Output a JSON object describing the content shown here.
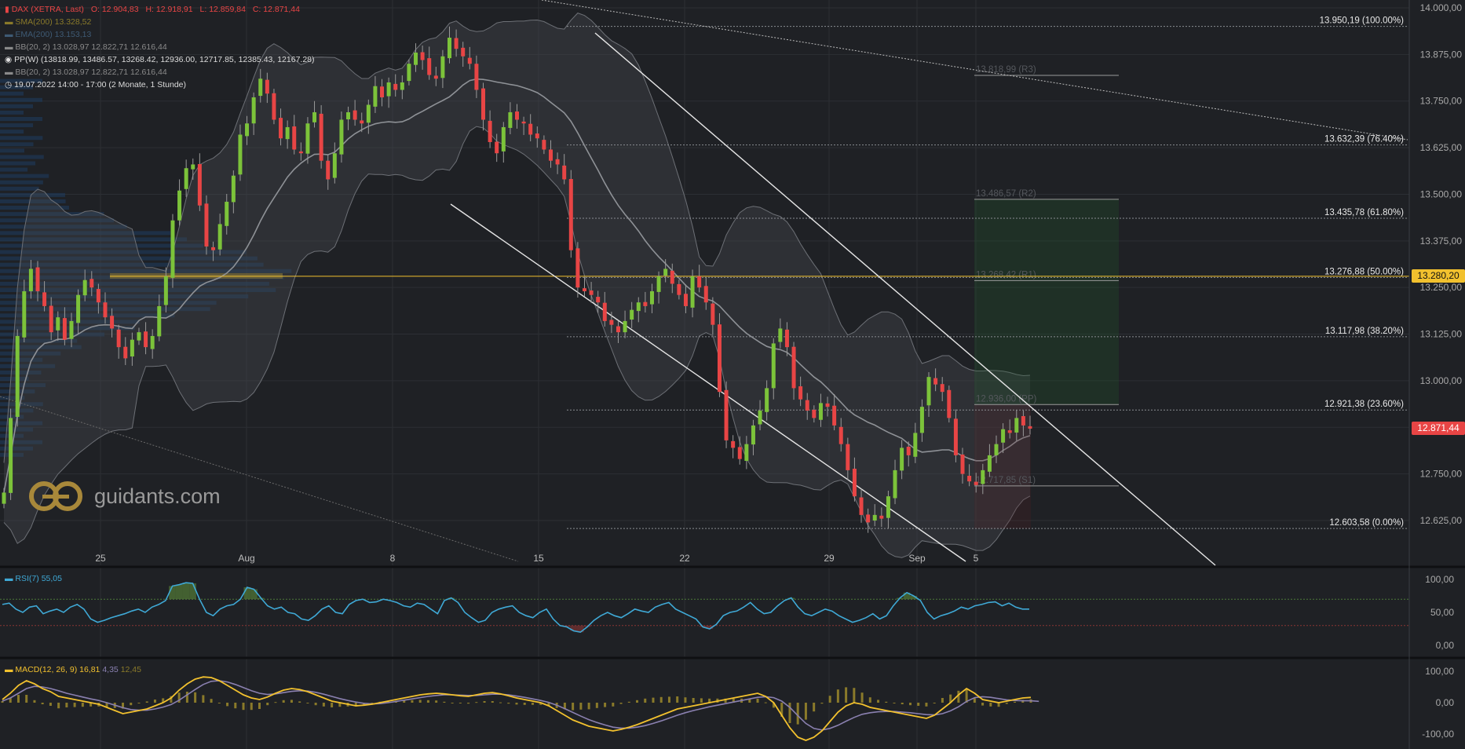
{
  "header": {
    "instrument": "DAX (XETRA, Last)",
    "ohlc": {
      "o": "O: 12.904,83",
      "h": "H: 12.918,91",
      "l": "L: 12.859,84",
      "c": "C: 12.871,44"
    },
    "indicators": [
      {
        "label": "SMA(200)",
        "value": "13.328,52",
        "color": "#8a7a2a"
      },
      {
        "label": "EMA(200)",
        "value": "13.153,13",
        "color": "#3e5a74"
      },
      {
        "label": "BB(20, 2)",
        "value": "13.028,97  12.822,71  12.616,44",
        "color": "#8a8a8a"
      },
      {
        "label": "PP(W)",
        "value": "(13818.99, 13486.57, 13268.42, 12936.00, 12717.85, 12385.43, 12167.28)",
        "color": "#e0e0e0"
      },
      {
        "label": "BB(20, 2)",
        "value": "13.028,97  12.822,71  12.616,44",
        "color": "#8a8a8a"
      },
      {
        "label": "19.07.2022 14:00 - 17:00",
        "value": "(2 Monate, 1 Stunde)",
        "color": "#e0e0e0"
      }
    ]
  },
  "logo": {
    "text": "guidants.com"
  },
  "price_tags": {
    "hline": {
      "text": "13.280,20",
      "color": "#f2c12e"
    },
    "last": {
      "text": "12.871,44",
      "color": "#e84545"
    }
  },
  "chart_data": [
    {
      "type": "candlestick",
      "name": "price",
      "x_tick_labels": [
        "25",
        "Aug",
        "8",
        "15",
        "22",
        "29",
        "Sep",
        "5"
      ],
      "y_tick_labels": [
        "14.000,00",
        "13.875,00",
        "13.750,00",
        "13.625,00",
        "13.500,00",
        "13.375,00",
        "13.250,00",
        "13.125,00",
        "13.000,00",
        "12.875,00",
        "12.750,00",
        "12.625,00"
      ],
      "ylim": [
        12555,
        14000
      ],
      "fib_levels": [
        {
          "label": "13.950,19 (100.00%)",
          "value": 13950.19
        },
        {
          "label": "13.632,39 (76.40%)",
          "value": 13632.39
        },
        {
          "label": "13.435,78 (61.80%)",
          "value": 13435.78
        },
        {
          "label": "13.276,88 (50.00%)",
          "value": 13276.88
        },
        {
          "label": "13.117,98 (38.20%)",
          "value": 13117.98
        },
        {
          "label": "12.921,38 (23.60%)",
          "value": 12921.38
        },
        {
          "label": "12.603,58 (0.00%)",
          "value": 12603.58
        }
      ],
      "pivot_levels": [
        {
          "label": "13.818,99 (R3)",
          "value": 13818.99
        },
        {
          "label": "13.486,57 (R2)",
          "value": 13486.57
        },
        {
          "label": "13.268,42 (R1)",
          "value": 13268.42
        },
        {
          "label": "12.936,00 (PP)",
          "value": 12936.0
        },
        {
          "label": "12.717,85 (S1)",
          "value": 12717.85
        }
      ],
      "horizontal_line": 13280.2,
      "last_price": 12871.44,
      "series": [
        {
          "name": "close",
          "values": [
            12700,
            12900,
            13120,
            13240,
            13300,
            13240,
            13200,
            13130,
            13170,
            13110,
            13160,
            13230,
            13270,
            13250,
            13210,
            13170,
            13140,
            13090,
            13060,
            13110,
            13130,
            13090,
            13120,
            13200,
            13280,
            13430,
            13510,
            13570,
            13580,
            13470,
            13360,
            13350,
            13420,
            13480,
            13550,
            13660,
            13690,
            13760,
            13810,
            13770,
            13700,
            13650,
            13680,
            13620,
            13610,
            13690,
            13720,
            13590,
            13540,
            13610,
            13700,
            13720,
            13700,
            13690,
            13740,
            13790,
            13760,
            13800,
            13780,
            13800,
            13850,
            13880,
            13860,
            13820,
            13810,
            13870,
            13920,
            13890,
            13870,
            13850,
            13780,
            13700,
            13640,
            13610,
            13680,
            13720,
            13700,
            13690,
            13660,
            13650,
            13620,
            13590,
            13580,
            13540,
            13350,
            13250,
            13240,
            13230,
            13210,
            13160,
            13150,
            13130,
            13160,
            13190,
            13210,
            13200,
            13240,
            13280,
            13300,
            13260,
            13230,
            13200,
            13280,
            13250,
            13210,
            13150,
            12970,
            12840,
            12820,
            12790,
            12830,
            12880,
            12920,
            12980,
            13100,
            13140,
            13090,
            12980,
            12950,
            12920,
            12900,
            12940,
            12930,
            12880,
            12830,
            12760,
            12690,
            12640,
            12620,
            12640,
            12630,
            12690,
            12760,
            12820,
            12800,
            12860,
            12930,
            13010,
            12990,
            12970,
            12900,
            12800,
            12750,
            12730,
            12720,
            12760,
            12800,
            12830,
            12870,
            12860,
            12900,
            12880,
            12871.44
          ]
        }
      ],
      "overlays": [
        "SMA(200)",
        "EMA(200)",
        "BB(20, 2)",
        "PP(W)",
        "Fibonacci retracement",
        "trend channel",
        "volume profile"
      ]
    },
    {
      "type": "line",
      "name": "RSI(7)",
      "label": "RSI(7)",
      "value_text": "55,05",
      "y_tick_labels": [
        "100,00",
        "50,00",
        "0,00"
      ],
      "ylim": [
        -10,
        115
      ],
      "bands": [
        70,
        30
      ],
      "series": [
        {
          "name": "RSI(7)",
          "values": [
            62,
            64,
            55,
            50,
            58,
            60,
            48,
            52,
            55,
            50,
            58,
            62,
            55,
            40,
            35,
            38,
            42,
            45,
            48,
            52,
            55,
            50,
            58,
            62,
            68,
            90,
            92,
            95,
            94,
            70,
            50,
            45,
            55,
            60,
            62,
            70,
            88,
            85,
            72,
            60,
            55,
            58,
            50,
            48,
            40,
            38,
            45,
            55,
            60,
            50,
            48,
            62,
            68,
            70,
            65,
            66,
            70,
            68,
            65,
            60,
            58,
            64,
            62,
            55,
            48,
            68,
            72,
            65,
            50,
            42,
            35,
            38,
            50,
            55,
            58,
            60,
            50,
            45,
            42,
            50,
            55,
            40,
            30,
            28,
            22,
            20,
            28,
            38,
            45,
            50,
            45,
            42,
            48,
            55,
            52,
            50,
            58,
            62,
            65,
            55,
            50,
            45,
            40,
            28,
            25,
            32,
            45,
            50,
            52,
            58,
            65,
            55,
            48,
            50,
            60,
            68,
            72,
            58,
            48,
            45,
            50,
            55,
            52,
            45,
            40,
            35,
            38,
            42,
            48,
            40,
            45,
            60,
            72,
            80,
            75,
            68,
            50,
            40,
            45,
            48,
            52,
            58,
            55,
            60,
            62,
            65,
            66,
            60,
            64,
            58,
            55,
            55.05
          ]
        }
      ]
    },
    {
      "type": "line",
      "name": "MACD(12, 26, 9)",
      "label": "MACD(12, 26, 9)",
      "value_text": "16,81",
      "signal_text": "4,35",
      "hist_text": "12,45",
      "y_tick_labels": [
        "100,00",
        "0,00",
        "-100,00"
      ],
      "ylim": [
        -140,
        115
      ],
      "series": [
        {
          "name": "MACD",
          "values": [
            10,
            30,
            55,
            70,
            60,
            45,
            35,
            20,
            15,
            10,
            5,
            0,
            -5,
            -15,
            -25,
            -35,
            -30,
            -25,
            -20,
            -10,
            0,
            15,
            40,
            60,
            75,
            82,
            80,
            70,
            55,
            40,
            25,
            15,
            10,
            18,
            30,
            40,
            45,
            42,
            35,
            25,
            15,
            5,
            0,
            -5,
            -10,
            -8,
            -5,
            0,
            5,
            10,
            15,
            20,
            25,
            28,
            30,
            28,
            25,
            22,
            20,
            25,
            30,
            32,
            28,
            22,
            15,
            10,
            5,
            0,
            -10,
            -25,
            -40,
            -55,
            -65,
            -75,
            -80,
            -85,
            -90,
            -85,
            -78,
            -70,
            -60,
            -50,
            -40,
            -30,
            -20,
            -15,
            -10,
            -5,
            0,
            5,
            10,
            15,
            20,
            25,
            30,
            20,
            0,
            -40,
            -80,
            -110,
            -120,
            -110,
            -90,
            -60,
            -30,
            -10,
            0,
            -5,
            -15,
            -20,
            -25,
            -30,
            -35,
            -40,
            -45,
            -50,
            -40,
            -20,
            0,
            25,
            45,
            30,
            10,
            5,
            0,
            5,
            10,
            15,
            16.81
          ]
        },
        {
          "name": "Signal",
          "values": [
            5,
            15,
            30,
            45,
            52,
            50,
            45,
            38,
            30,
            24,
            18,
            12,
            7,
            0,
            -8,
            -16,
            -22,
            -24,
            -24,
            -20,
            -14,
            -6,
            8,
            25,
            42,
            58,
            68,
            70,
            66,
            58,
            48,
            38,
            30,
            26,
            28,
            32,
            36,
            38,
            37,
            33,
            27,
            20,
            13,
            7,
            2,
            -2,
            -4,
            -3,
            0,
            4,
            8,
            12,
            16,
            20,
            23,
            25,
            25,
            24,
            23,
            23,
            25,
            27,
            27,
            25,
            21,
            17,
            12,
            7,
            1,
            -8,
            -19,
            -31,
            -43,
            -54,
            -63,
            -71,
            -78,
            -81,
            -81,
            -78,
            -73,
            -66,
            -58,
            -49,
            -40,
            -32,
            -25,
            -19,
            -13,
            -8,
            -3,
            2,
            7,
            12,
            17,
            19,
            16,
            5,
            -15,
            -41,
            -66,
            -82,
            -87,
            -82,
            -72,
            -59,
            -47,
            -37,
            -32,
            -29,
            -28,
            -28,
            -30,
            -32,
            -35,
            -38,
            -39,
            -35,
            -26,
            -13,
            4,
            16,
            19,
            17,
            13,
            9,
            7,
            6,
            6,
            4.35
          ]
        }
      ]
    }
  ]
}
